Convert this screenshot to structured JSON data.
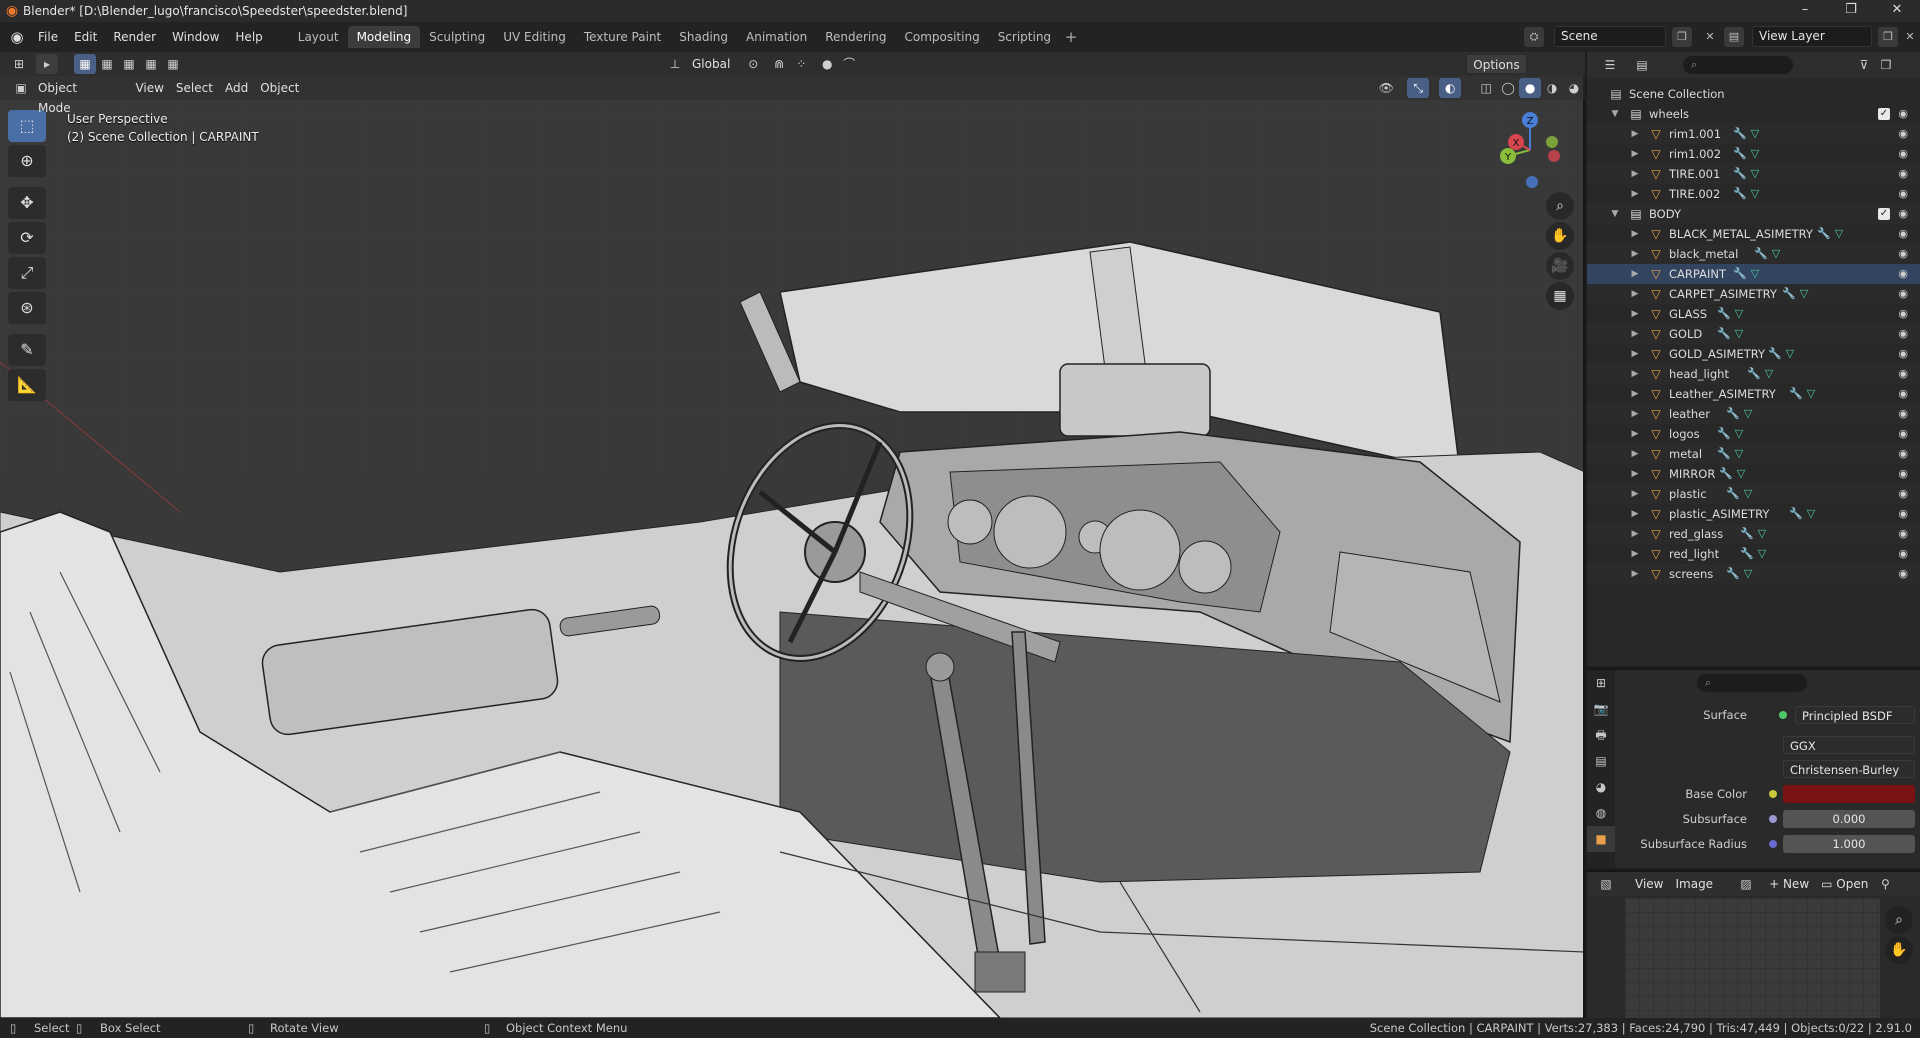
{
  "window": {
    "title": "Blender* [D:\\Blender_lugo\\francisco\\Speedster\\speedster.blend]",
    "minimize": "–",
    "maximize": "❐",
    "close": "✕"
  },
  "menu": [
    "File",
    "Edit",
    "Render",
    "Window",
    "Help"
  ],
  "workspaces": {
    "tabs": [
      "Layout",
      "Modeling",
      "Sculpting",
      "UV Editing",
      "Texture Paint",
      "Shading",
      "Animation",
      "Rendering",
      "Compositing",
      "Scripting"
    ],
    "active": "Modeling",
    "add": "+"
  },
  "scene": {
    "label": "Scene",
    "view_layer": "View Layer"
  },
  "viewport": {
    "mode": "Object Mode",
    "menus": [
      "View",
      "Select",
      "Add",
      "Object"
    ],
    "transform_orientation": "Global",
    "options_label": "Options",
    "info_line1": "User Perspective",
    "info_line2": "(2) Scene Collection | CARPAINT",
    "gizmo_axes": {
      "x": "X",
      "y": "Y",
      "z": "Z"
    }
  },
  "toolbar": {
    "tools": [
      "select-box-tool",
      "cursor-tool",
      "move-tool",
      "rotate-tool",
      "scale-tool",
      "transform-tool",
      "annotate-tool",
      "measure-tool"
    ]
  },
  "outliner": {
    "root": "Scene Collection",
    "collections": [
      {
        "name": "wheels",
        "objects": [
          "rim1.001",
          "rim1.002",
          "TIRE.001",
          "TIRE.002"
        ]
      },
      {
        "name": "BODY",
        "objects": [
          "BLACK_METAL_ASIMETRY",
          "black_metal",
          "CARPAINT",
          "CARPET_ASIMETRY",
          "GLASS",
          "GOLD",
          "GOLD_ASIMETRY",
          "head_light",
          "Leather_ASIMETRY",
          "leather",
          "logos",
          "metal",
          "MIRROR",
          "plastic",
          "plastic_ASIMETRY",
          "red_glass",
          "red_light",
          "screens"
        ]
      }
    ],
    "selected": "CARPAINT",
    "check": "✓"
  },
  "properties": {
    "surface_label": "Surface",
    "surface_value": "Principled BSDF",
    "distribution": "GGX",
    "subsurface_method": "Christensen-Burley",
    "base_color_label": "Base Color",
    "base_color": "#7a1414",
    "subsurface_label": "Subsurface",
    "subsurface_value": "0.000",
    "subsurface_radius_label": "Subsurface Radius",
    "subsurface_radius_value": "1.000"
  },
  "image_editor": {
    "menus": [
      "View",
      "Image"
    ],
    "new_label": "New",
    "open_label": "Open"
  },
  "statusbar": {
    "select": "Select",
    "box_select": "Box Select",
    "rotate_view": "Rotate View",
    "context_menu": "Object Context Menu",
    "stats": "Scene Collection | CARPAINT | Verts:27,383 | Faces:24,790 | Tris:47,449 | Objects:0/22 | 2.91.0"
  },
  "colors": {
    "accent": "#4a6fa5",
    "object_icon": "#e8a04a",
    "modifier_icon": "#6fa8dc",
    "data_icon": "#4ec9a0"
  }
}
